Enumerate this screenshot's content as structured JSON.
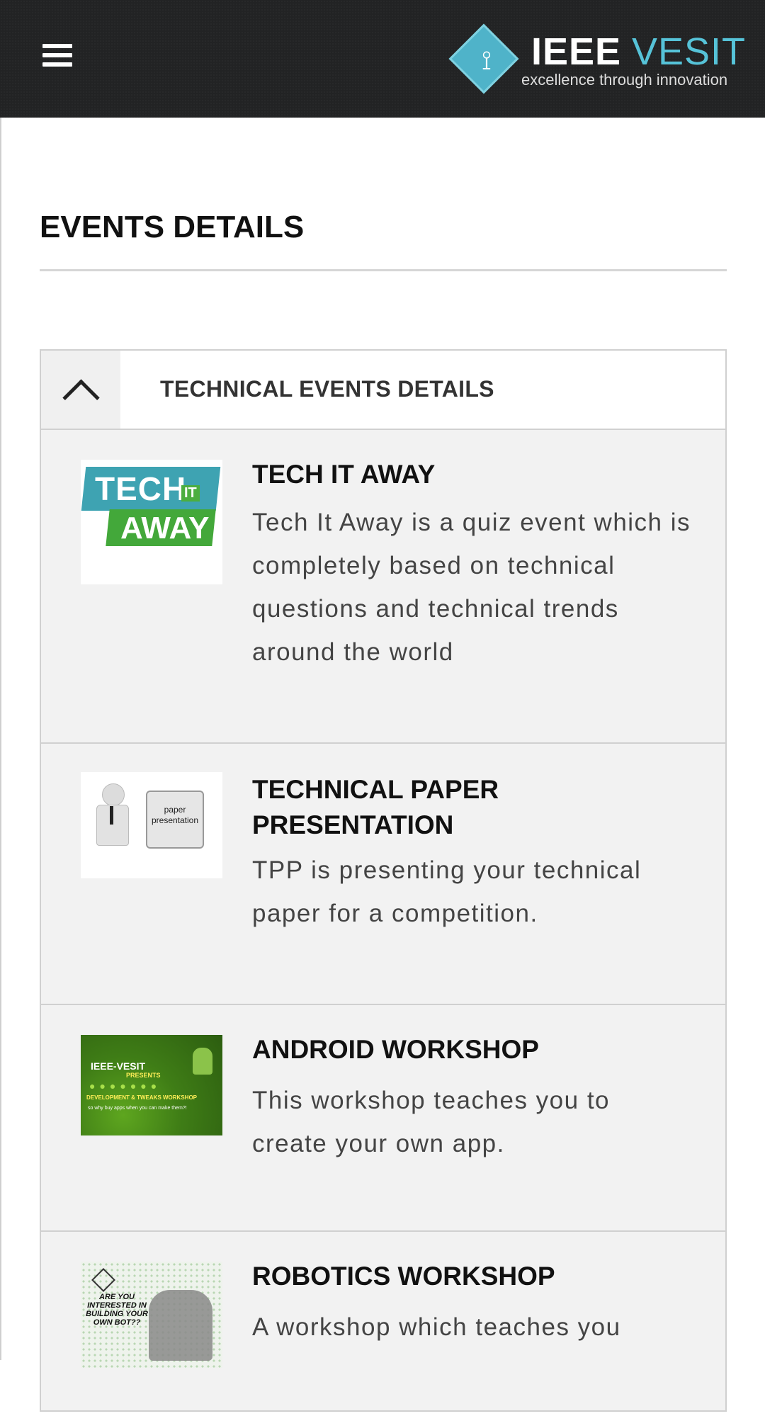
{
  "header": {
    "menu_icon": "hamburger-menu-icon",
    "logo_word1": "IEEE",
    "logo_word2": "VESIT",
    "logo_tagline": "excellence through innovation",
    "logo_icon": "ieee-diamond-icon",
    "logo_accent_color": "#56c3d8"
  },
  "page": {
    "title": "EVENTS DETAILS"
  },
  "panel": {
    "title": "TECHNICAL EVENTS DETAILS",
    "toggle_icon": "chevron-up-icon",
    "expanded": true
  },
  "events": [
    {
      "title": "TECH IT AWAY",
      "description": "Tech It Away is a quiz event which is completely based on technical questions and technical trends around the world",
      "thumbnail": {
        "top": "TECH",
        "mid": "IT",
        "bottom": "AWAY"
      }
    },
    {
      "title": "TECHNICAL PAPER PRESENTATION",
      "description": "TPP is presenting your technical paper for a competition.",
      "thumbnail": {
        "board_line1": "paper",
        "board_line2": "presentation"
      }
    },
    {
      "title": "ANDROID WORKSHOP",
      "description": "This workshop teaches you to create your own app.",
      "thumbnail": {
        "line1": "IEEE-VESIT",
        "line2": "PRESENTS",
        "line3": "DEVELOPMENT & TWEAKS WORKSHOP",
        "line4": "so why buy apps when you can make them?!"
      }
    },
    {
      "title": "ROBOTICS WORKSHOP",
      "description": "A workshop which teaches you",
      "thumbnail": {
        "text": "ARE YOU INTERESTED IN BUILDING YOUR OWN BOT??"
      }
    }
  ]
}
